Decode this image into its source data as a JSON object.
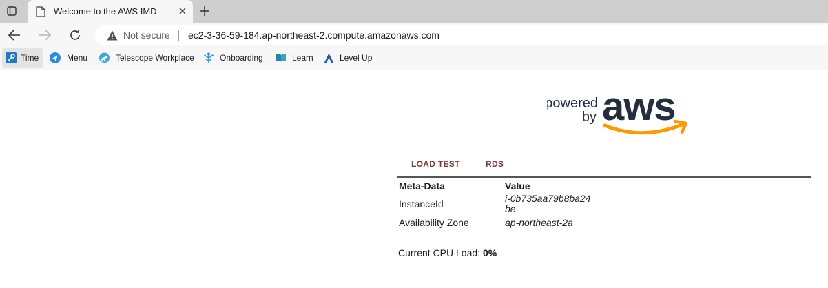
{
  "browser": {
    "tab_title": "Welcome to the AWS IMD",
    "security_label": "Not secure",
    "url": "ec2-3-36-59-184.ap-northeast-2.compute.amazonaws.com",
    "bookmarks": [
      {
        "label": "Time",
        "icon": "key-icon"
      },
      {
        "label": "Menu",
        "icon": "navigation-arrow-icon"
      },
      {
        "label": "Telescope Workplace",
        "icon": "telescope-icon"
      },
      {
        "label": "Onboarding",
        "icon": "tree-icon"
      },
      {
        "label": "Learn",
        "icon": "book-icon"
      },
      {
        "label": "Level Up",
        "icon": "level-up-icon"
      }
    ]
  },
  "logo": {
    "line1": "powered",
    "line2": "by",
    "brand": "aws",
    "brand_color": "#232f3e",
    "smile_color": "#ff9900"
  },
  "nav": {
    "load_test": "LOAD TEST",
    "rds": "RDS",
    "link_color": "#7b3a3a"
  },
  "metadata": {
    "header_key": "Meta-Data",
    "header_value": "Value",
    "rows": [
      {
        "key": "InstanceId",
        "value": "i-0b735aa79b8ba24be"
      },
      {
        "key": "Availability Zone",
        "value": "ap-northeast-2a"
      }
    ]
  },
  "cpu": {
    "label": "Current CPU Load:",
    "value": "0%"
  }
}
